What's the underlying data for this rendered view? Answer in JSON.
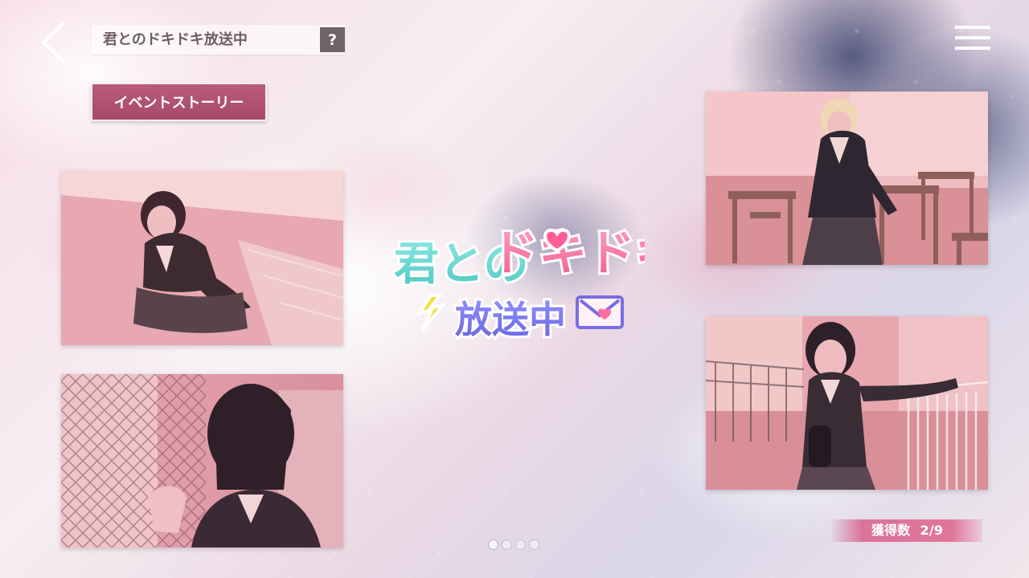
{
  "header": {
    "title": "君とのドキドキ放送中",
    "help_label": "?"
  },
  "event_story_button_label": "イベントストーリー",
  "logo_lines": [
    "君とのドキドキ",
    "放送中"
  ],
  "page_indicator": {
    "current": 1,
    "total": 4
  },
  "acquired": {
    "label": "獲得数",
    "value": "2/9"
  },
  "colors": {
    "accent": "#b95c7b",
    "help_bg": "#6f6468",
    "badge": "#d86e95"
  },
  "icons": [
    "back-arrow-icon",
    "hamburger-menu-icon",
    "help-icon",
    "logo-heart-icon",
    "logo-lightning-icon",
    "logo-envelope-icon"
  ]
}
